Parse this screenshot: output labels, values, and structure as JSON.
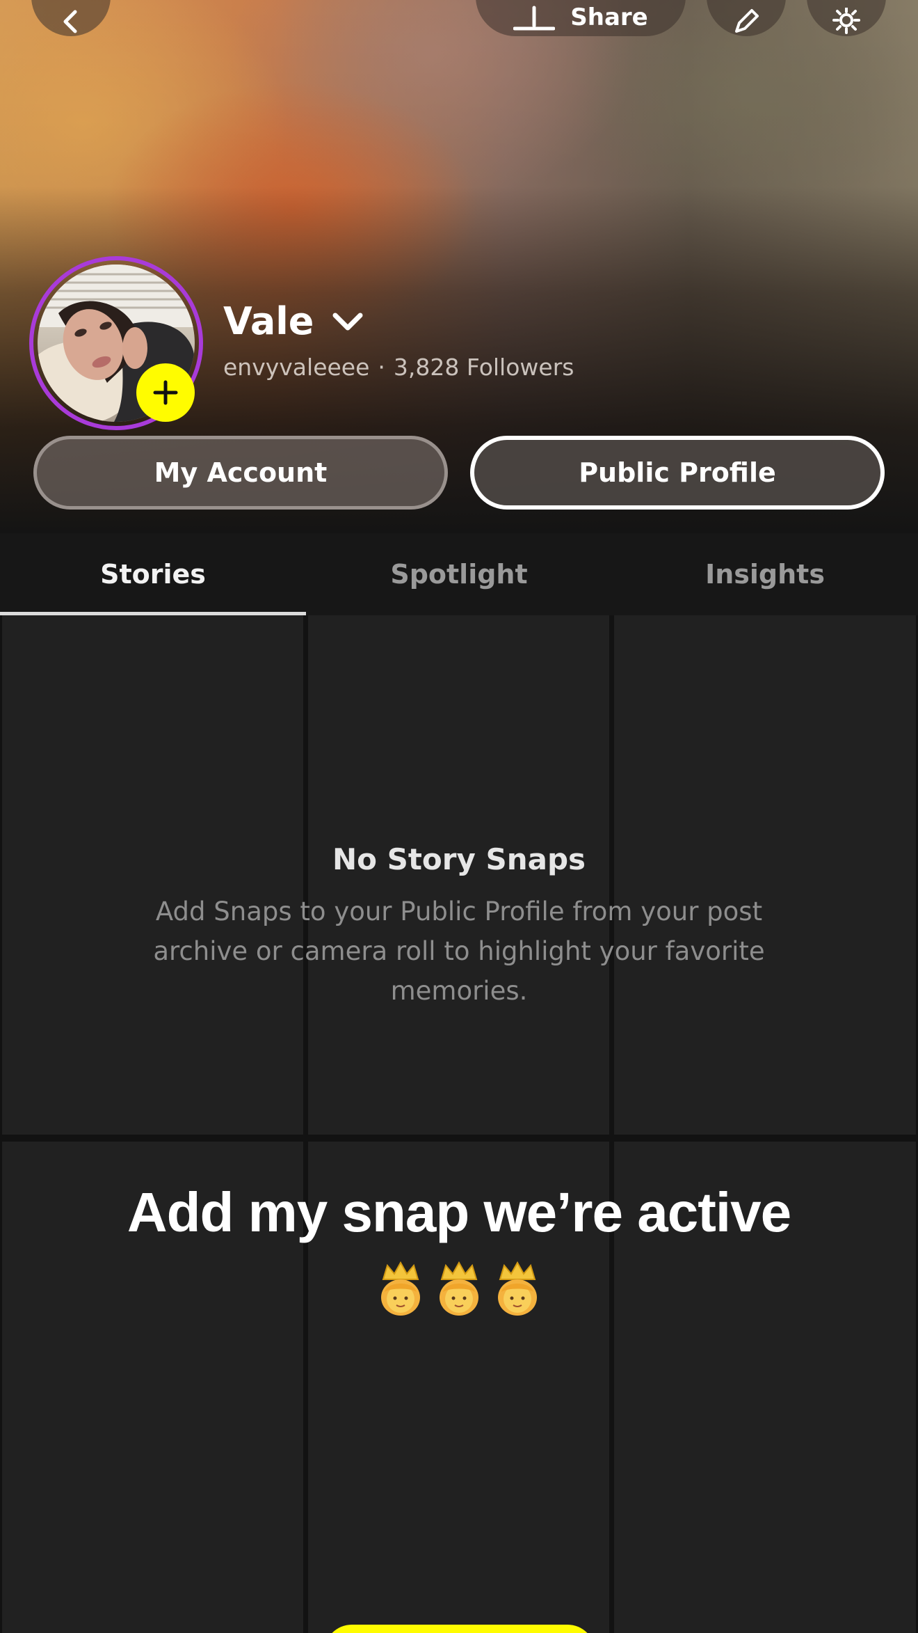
{
  "header": {
    "share_label": "Share",
    "icons": {
      "back": "chevron-left-icon",
      "share": "share-upload-icon",
      "edit": "pencil-icon",
      "settings": "gear-icon"
    }
  },
  "profile": {
    "display_name": "Vale",
    "username": "envyvaleeee",
    "separator": "·",
    "followers": "3,828 Followers",
    "avatar_ring_color": "#a93bd9",
    "add_badge_color": "#fffc00"
  },
  "actions": {
    "my_account": "My Account",
    "public_profile": "Public Profile"
  },
  "tabs": [
    {
      "label": "Stories",
      "active": true
    },
    {
      "label": "Spotlight",
      "active": false
    },
    {
      "label": "Insights",
      "active": false
    }
  ],
  "empty_state": {
    "title": "No Story Snaps",
    "description": "Add Snaps to your Public Profile from your post archive or camera roll to highlight your favorite memories."
  },
  "overlay": {
    "caption": "Add my snap we’re active",
    "emoji": [
      "princess-emoji",
      "princess-emoji",
      "princess-emoji"
    ]
  },
  "colors": {
    "accent_yellow": "#fffc00",
    "tile_bg": "#212121"
  }
}
